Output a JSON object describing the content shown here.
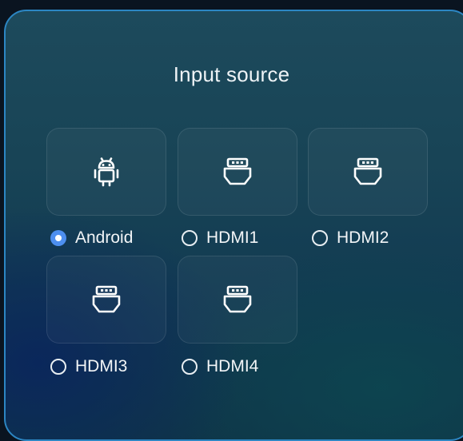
{
  "dialog": {
    "title": "Input source"
  },
  "sources": [
    {
      "label": "Android",
      "icon": "android-icon",
      "selected": true
    },
    {
      "label": "HDMI1",
      "icon": "hdmi-icon",
      "selected": false
    },
    {
      "label": "HDMI2",
      "icon": "hdmi-icon",
      "selected": false
    },
    {
      "label": "HDMI3",
      "icon": "hdmi-icon",
      "selected": false
    },
    {
      "label": "HDMI4",
      "icon": "hdmi-icon",
      "selected": false
    }
  ],
  "colors": {
    "accent": "#4d8ff0",
    "border": "#2c86c3"
  }
}
